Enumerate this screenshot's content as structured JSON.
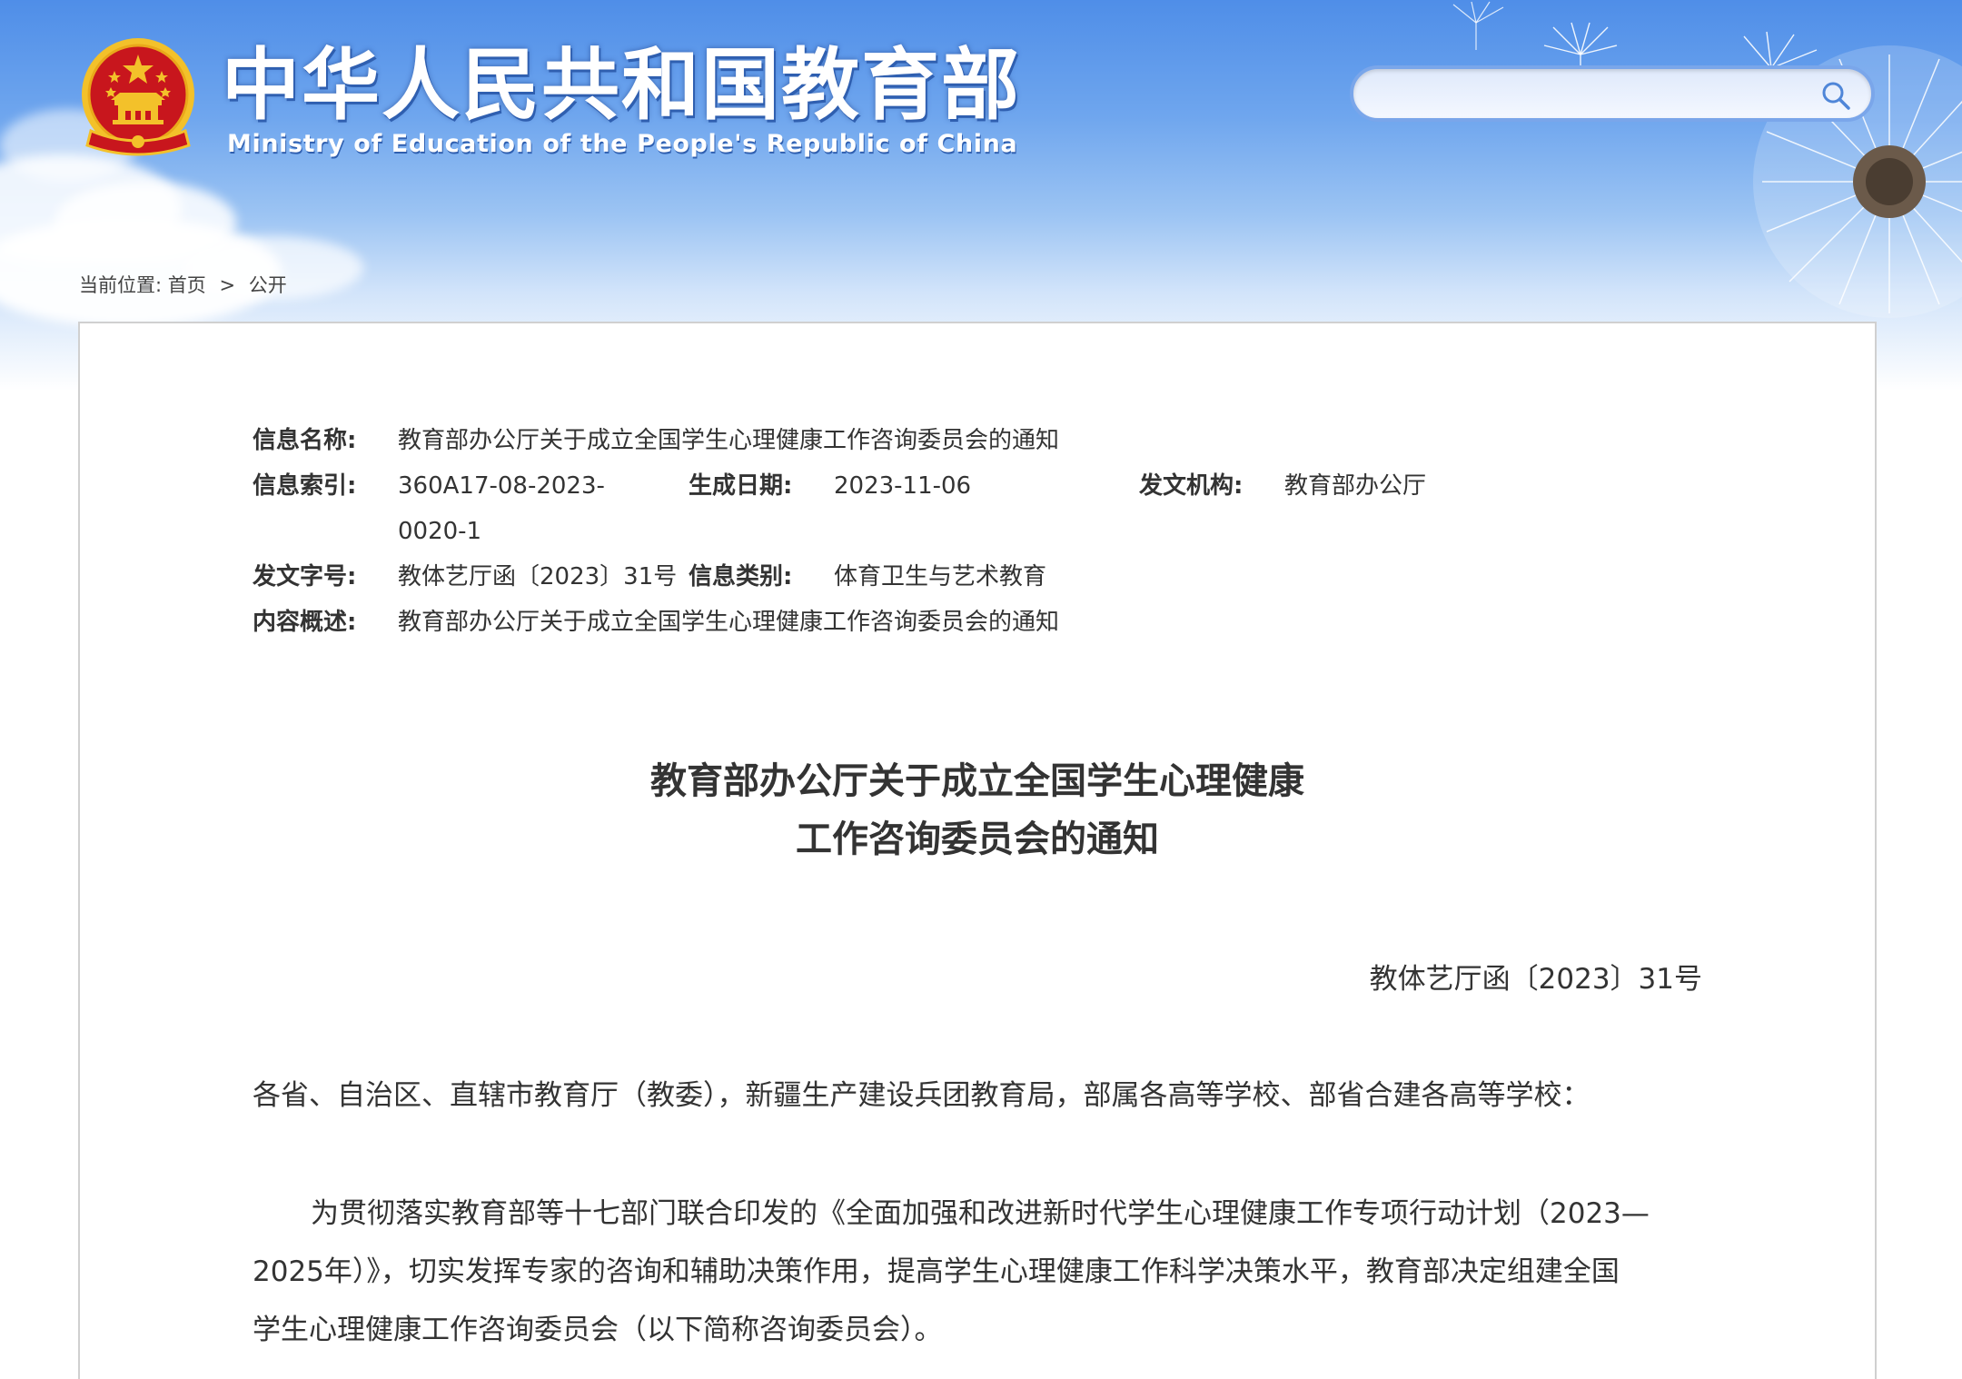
{
  "header": {
    "title_cn": "中华人民共和国教育部",
    "title_en": "Ministry of Education of the People's Republic of China",
    "emblem_icon": "national-emblem-icon",
    "search": {
      "placeholder": "",
      "value": "",
      "icon": "search-icon"
    }
  },
  "breadcrumb": {
    "prefix": "当前位置:",
    "items": [
      "首页",
      "公开"
    ],
    "separator": ">"
  },
  "meta": {
    "name_label": "信息名称:",
    "name_value": "教育部办公厅关于成立全国学生心理健康工作咨询委员会的通知",
    "index_label": "信息索引:",
    "index_value_line1": "360A17-08-2023-",
    "index_value_line2": "0020-1",
    "date_label": "生成日期:",
    "date_value": "2023-11-06",
    "org_label": "发文机构:",
    "org_value": "教育部办公厅",
    "docno_label": "发文字号:",
    "docno_value": "教体艺厅函〔2023〕31号",
    "category_label": "信息类别:",
    "category_value": "体育卫生与艺术教育",
    "summary_label": "内容概述:",
    "summary_value": "教育部办公厅关于成立全国学生心理健康工作咨询委员会的通知"
  },
  "document": {
    "title_line1": "教育部办公厅关于成立全国学生心理健康",
    "title_line2": "工作咨询委员会的通知",
    "number": "教体艺厅函〔2023〕31号",
    "salutation": "各省、自治区、直辖市教育厅（教委），新疆生产建设兵团教育局，部属各高等学校、部省合建各高等学校：",
    "paragraph_line1": "为贯彻落实教育部等十七部门联合印发的《全面加强和改进新时代学生心理健康工作专项行动计划（2023—",
    "paragraph_line2": "2025年）》，切实发挥专家的咨询和辅助决策作用，提高学生心理健康工作科学决策水平，教育部决定组建全国",
    "paragraph_line3": "学生心理健康工作咨询委员会（以下简称咨询委员会）。"
  },
  "colors": {
    "banner_top": "#4f8ee8",
    "title_shadow": "#2f5fb0",
    "emblem_red": "#c8161d",
    "emblem_gold": "#f3c12a"
  }
}
